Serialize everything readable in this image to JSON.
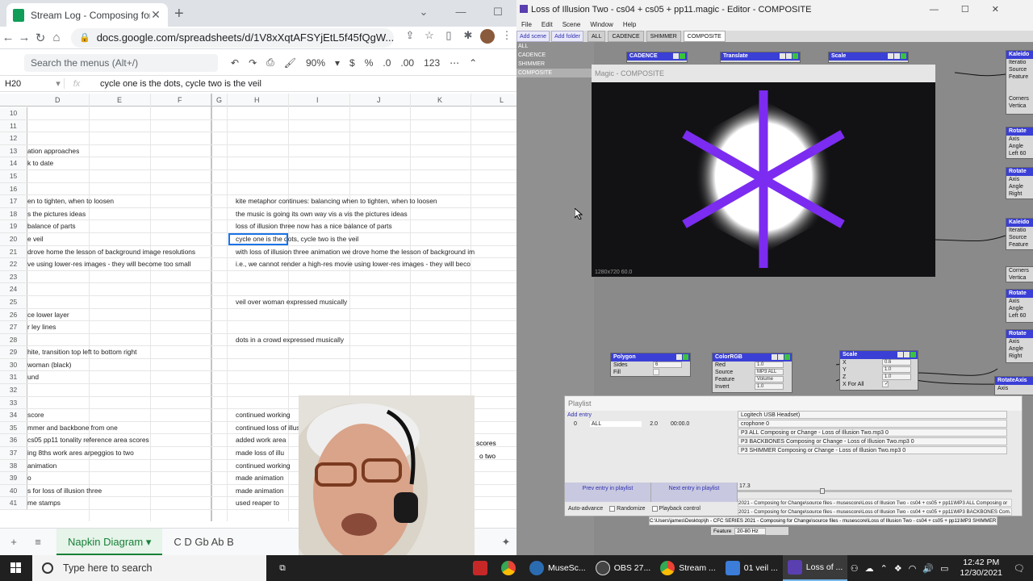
{
  "chrome": {
    "tab_title": "Stream Log - Composing for Cha",
    "url": "docs.google.com/spreadsheets/d/1V8xXqtAFSYjEtL5f45fQgW..."
  },
  "sheets": {
    "menu_search": "Search the menus (Alt+/)",
    "zoom": "90%",
    "currency": "$",
    "percent": "%",
    "dec_less": ".0",
    "dec_more": ".00",
    "number_format": "123",
    "cell_ref": "H20",
    "fx_value": "cycle one is the dots, cycle two is the veil",
    "columns": [
      "D",
      "E",
      "F",
      "G",
      "H",
      "I",
      "J",
      "K",
      "L"
    ],
    "rows": [
      {
        "n": "10",
        "d": "",
        "h": ""
      },
      {
        "n": "11",
        "d": "",
        "h": ""
      },
      {
        "n": "12",
        "d": "",
        "h": ""
      },
      {
        "n": "13",
        "d": "ation approaches",
        "h": ""
      },
      {
        "n": "14",
        "d": "k to date",
        "h": ""
      },
      {
        "n": "15",
        "d": "",
        "h": ""
      },
      {
        "n": "16",
        "d": "",
        "h": ""
      },
      {
        "n": "17",
        "d": "en to tighten, when to loosen",
        "h": "kite metaphor continues: balancing when to tighten, when to loosen"
      },
      {
        "n": "18",
        "d": "s the pictures ideas",
        "h": "the music is going its own way vis a vis the pictures ideas"
      },
      {
        "n": "19",
        "d": "balance of parts",
        "h": "loss of illusion three now has a nice balance of parts"
      },
      {
        "n": "20",
        "d": "e veil",
        "h": "   cycle one is the dots, cycle two is the veil"
      },
      {
        "n": "21",
        "d": "drove home the lesson of background image resolutions",
        "h": "with loss of illusion three animation we drove home the lesson of background im"
      },
      {
        "n": "22",
        "d": "ve using lower-res images - they will become too small",
        "h": "   i.e., we cannot render a high-res movie using lower-res images - they will beco"
      },
      {
        "n": "23",
        "d": "",
        "h": ""
      },
      {
        "n": "24",
        "d": "",
        "h": ""
      },
      {
        "n": "25",
        "d": "",
        "h": "veil over woman expressed musically"
      },
      {
        "n": "26",
        "d": "ce lower layer",
        "h": ""
      },
      {
        "n": "27",
        "d": "r ley lines",
        "h": ""
      },
      {
        "n": "28",
        "d": "",
        "h": "dots in a crowd expressed musically"
      },
      {
        "n": "29",
        "d": "hite, transition top left to bottom right",
        "h": ""
      },
      {
        "n": "30",
        "d": "woman (black)",
        "h": ""
      },
      {
        "n": "31",
        "d": "und",
        "h": ""
      },
      {
        "n": "32",
        "d": "",
        "h": ""
      },
      {
        "n": "33",
        "d": "",
        "h": ""
      },
      {
        "n": "34",
        "d": "score",
        "h": "continued working"
      },
      {
        "n": "35",
        "d": "mmer and backbone from one",
        "h": "   continued loss of illusion tw"
      },
      {
        "n": "36",
        "d": "cs05 pp11 tonality reference area scores",
        "h": "   added work area"
      },
      {
        "n": "37",
        "d": "ing 8ths work ares arpeggios to two",
        "h": "   made loss of illu"
      },
      {
        "n": "38",
        "d": "animation",
        "h": "continued working"
      },
      {
        "n": "39",
        "d": "o",
        "h": "   made animation"
      },
      {
        "n": "40",
        "d": "s for loss of illusion three",
        "h": "   made animation"
      },
      {
        "n": "41",
        "d": "me stamps",
        "h": "   used reaper to"
      }
    ],
    "overflow_right": {
      "r36": "scores",
      "r37": "o two"
    },
    "sheet_tab_active": "Napkin Diagram",
    "sheet_tab_next": "C D Gb Ab B"
  },
  "magic": {
    "title": "Loss of Illusion Two - cs04 + cs05 + pp11.magic - Editor - COMPOSITE",
    "menus": [
      "File",
      "Edit",
      "Scene",
      "Window",
      "Help"
    ],
    "add_scene": "Add scene",
    "add_folder": "Add folder",
    "tabs": [
      "ALL",
      "CADENCE",
      "SHIMMER",
      "COMPOSITE"
    ],
    "scenes": [
      "ALL",
      "CADENCE",
      "SHIMMER",
      "COMPOSITE"
    ],
    "preview_title": "Magic - COMPOSITE",
    "preview_footer": "1280x720  60.0",
    "nodes": {
      "cadence": "CADENCE",
      "translate": "Translate",
      "scale_top": "Scale",
      "kaleido1": "Kaleido",
      "polygon": "Polygon",
      "polygon_sides_label": "Sides",
      "polygon_sides": "6",
      "polygon_fill": "Fill",
      "colorrgb": "ColorRGB",
      "color_red_label": "Red",
      "color_red": "1.0",
      "color_source_label": "Source",
      "color_source": "MP3 ALL",
      "color_feature_label": "Feature",
      "color_feature": "Volume",
      "color_invert_label": "Invert",
      "color_invert": "1.0",
      "scale2": "Scale",
      "scale_x_label": "X",
      "scale_x": "0.6",
      "scale_y_label": "Y",
      "scale_y": "1.0",
      "scale_z_label": "Z",
      "scale_z": "1.0",
      "scale_forall": "X For All",
      "rotate": "Rotate",
      "rotateaxis": "RotateAxis",
      "right_labels": [
        "Iteratio",
        "Source",
        "Feature",
        "Corners",
        "Vertica",
        "Axis",
        "Angle",
        "Left 60",
        "Right"
      ]
    },
    "playlist": {
      "title": "Playlist",
      "add_entry": "Add entry",
      "entry_index": "0",
      "entry_name": "ALL",
      "entry_duration": "2.0",
      "entry_time": "00:00.0",
      "device": "Logitech USB Headset)",
      "items": [
        "crophone 0",
        "P3 ALL Composing or Change - Loss of Illusion Two.mp3 0",
        "P3 BACKBONES Composing or Change - Loss of Illusion Two.mp3 0",
        "P3 SHIMMER Composing or Change - Loss of Illusion Two.mp3 0"
      ],
      "prev": "Prev entry in playlist",
      "next": "Next entry in playlist",
      "auto_advance": "Auto-advance",
      "randomize": "Randomize",
      "playback": "Playback control",
      "slider_value": "17.3",
      "paths": [
        "2021 - Composing for Change\\source files - musescore\\Loss of Illusion Two - cs04 + cs05 + pp11\\MP3 ALL Composing or",
        "2021 - Composing for Change\\source files - musescore\\Loss of Illusion Two - cs04 + cs05 + pp11\\MP3 BACKBONES Com...",
        "C:\\Users\\james\\Desktop\\jh - CFC SERIES 2021 - Composing for Change\\source files - musescore\\Loss of Illusion Two - cs04 + cs05 + pp11\\MP3 SHIMMER Compo"
      ],
      "feature_label": "Feature",
      "feature_value": "20-80 Hz"
    }
  },
  "taskbar": {
    "search": "Type here to search",
    "apps": [
      {
        "label": "",
        "color": "#c62828"
      },
      {
        "label": "",
        "color": "#4caf50"
      },
      {
        "label": "MuseSc...",
        "color": "#2b6cb0"
      },
      {
        "label": "OBS 27...",
        "color": "#444444"
      },
      {
        "label": "Stream ...",
        "color": "#4caf50"
      },
      {
        "label": "01 veil ...",
        "color": "#3b7dd8"
      },
      {
        "label": "Loss of ...",
        "color": "#5a3fb0"
      }
    ],
    "time": "12:42 PM",
    "date": "12/30/2021"
  },
  "colors": {
    "accent_sheet": "#188038",
    "select_blue": "#1a73e8",
    "node_header": "#3a3fd6",
    "star_purple": "#7b2cf0"
  }
}
